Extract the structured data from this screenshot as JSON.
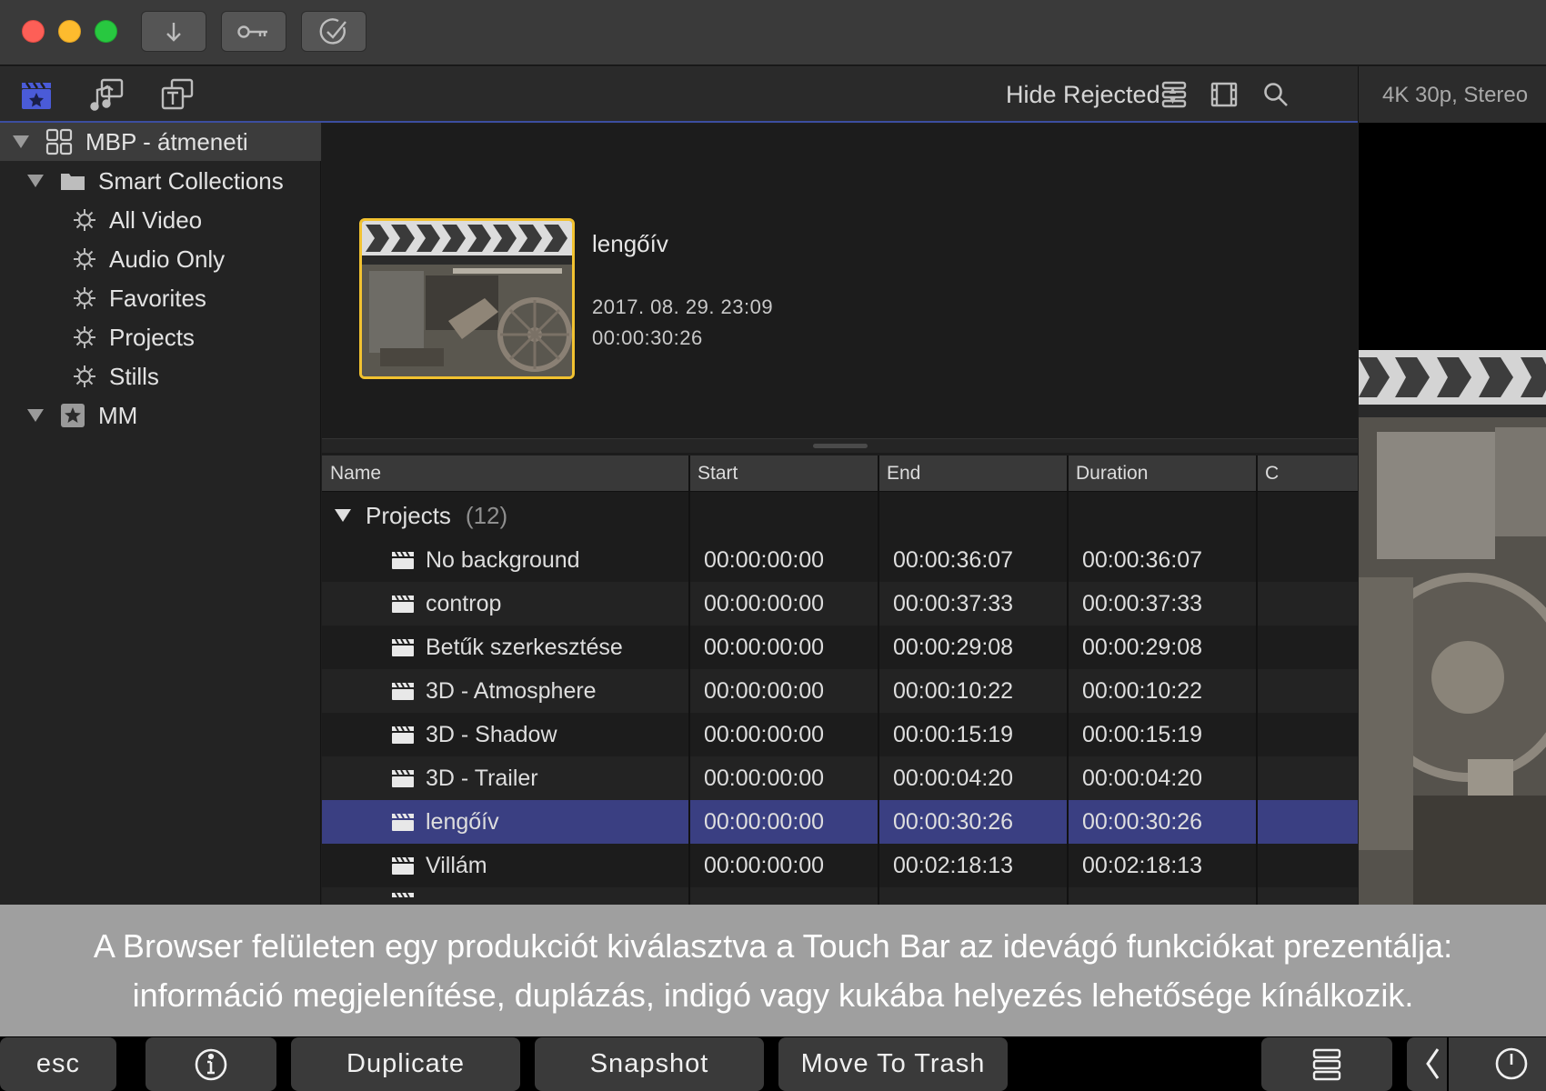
{
  "titlebar": {
    "buttons": [
      {
        "name": "import-button",
        "icon": "download-arrow-icon"
      },
      {
        "name": "keywords-button",
        "icon": "key-icon"
      },
      {
        "name": "background-tasks-button",
        "icon": "checkmark-circle-icon"
      }
    ]
  },
  "toolbar": {
    "filter_label": "Hide Rejected",
    "format_info": "4K 30p, Stereo"
  },
  "sidebar": {
    "library": "MBP - átmeneti",
    "smart_collections_label": "Smart Collections",
    "smart_collections": [
      "All Video",
      "Audio Only",
      "Favorites",
      "Projects",
      "Stills"
    ],
    "event": "MM"
  },
  "inspector": {
    "title": "lengőív",
    "date": "2017. 08. 29. 23:09",
    "duration": "00:00:30:26"
  },
  "list": {
    "columns": [
      "Name",
      "Start",
      "End",
      "Duration",
      "C"
    ],
    "group_label": "Projects",
    "group_count": "(12)",
    "rows": [
      {
        "name": "No background",
        "start": "00:00:00:00",
        "end": "00:00:36:07",
        "duration": "00:00:36:07"
      },
      {
        "name": "controp",
        "start": "00:00:00:00",
        "end": "00:00:37:33",
        "duration": "00:00:37:33"
      },
      {
        "name": "Betűk szerkesztése",
        "start": "00:00:00:00",
        "end": "00:00:29:08",
        "duration": "00:00:29:08"
      },
      {
        "name": "3D - Atmosphere",
        "start": "00:00:00:00",
        "end": "00:00:10:22",
        "duration": "00:00:10:22"
      },
      {
        "name": "3D - Shadow",
        "start": "00:00:00:00",
        "end": "00:00:15:19",
        "duration": "00:00:15:19"
      },
      {
        "name": "3D - Trailer",
        "start": "00:00:00:00",
        "end": "00:00:04:20",
        "duration": "00:00:04:20"
      },
      {
        "name": "lengőív",
        "start": "00:00:00:00",
        "end": "00:00:30:26",
        "duration": "00:00:30:26",
        "selected": true
      },
      {
        "name": "Villám",
        "start": "00:00:00:00",
        "end": "00:02:18:13",
        "duration": "00:02:18:13"
      }
    ]
  },
  "caption": "A Browser felületen egy produkciót kiválasztva a Touch Bar az idevágó funkciókat prezentálja: információ megjelenítése, duplázás, indigó vagy kukába helyezés lehetősége kínálkozik.",
  "touchbar": {
    "esc": "esc",
    "duplicate": "Duplicate",
    "snapshot": "Snapshot",
    "trash": "Move To Trash"
  },
  "colors": {
    "selection": "#3a3f82",
    "thumbnail_border": "#f2c230",
    "accent_line": "#3c4ea0"
  }
}
